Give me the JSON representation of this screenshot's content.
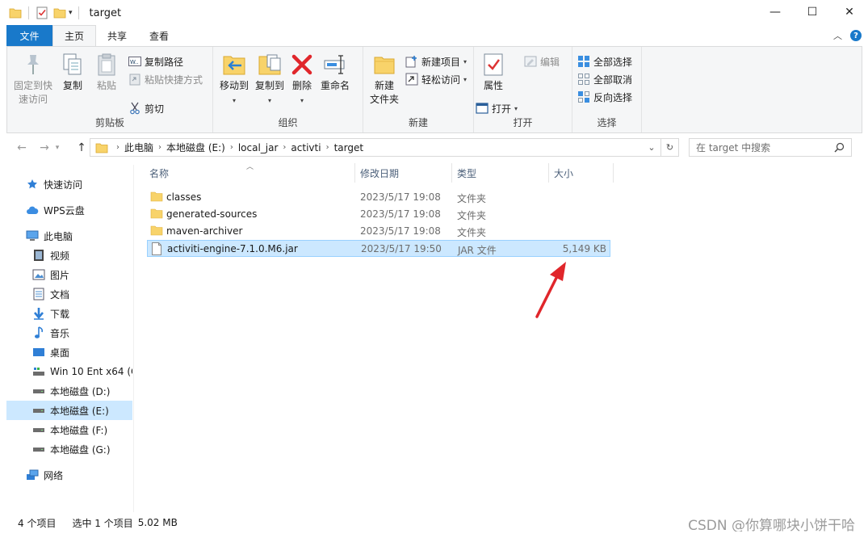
{
  "window": {
    "title": "target",
    "controls": {
      "minimize": "—",
      "maximize": "☐",
      "close": "✕"
    }
  },
  "tabs": [
    {
      "label": "文件"
    },
    {
      "label": "主页"
    },
    {
      "label": "共享"
    },
    {
      "label": "查看"
    }
  ],
  "ribbon": {
    "clipboard": {
      "pin": "固定到快\n速访问",
      "copy": "复制",
      "paste": "粘贴",
      "copy_path": "复制路径",
      "paste_shortcut": "粘贴快捷方式",
      "cut": "剪切",
      "label": "剪贴板"
    },
    "organize": {
      "move_to": "移动到",
      "copy_to": "复制到",
      "delete": "删除",
      "rename": "重命名",
      "label": "组织"
    },
    "new": {
      "new_folder": "新建\n文件夹",
      "new_item": "新建项目",
      "easy_access": "轻松访问",
      "label": "新建"
    },
    "open": {
      "properties": "属性",
      "open": "打开",
      "edit": "编辑",
      "label": "打开"
    },
    "select": {
      "select_all": "全部选择",
      "select_none": "全部取消",
      "invert": "反向选择",
      "label": "选择"
    }
  },
  "address": {
    "crumbs": [
      "此电脑",
      "本地磁盘 (E:)",
      "local_jar",
      "activti",
      "target"
    ]
  },
  "search": {
    "placeholder": "在 target 中搜索"
  },
  "nav": {
    "items": [
      {
        "label": "快速访问",
        "icon": "star-icon"
      },
      {
        "label": "WPS云盘",
        "icon": "cloud-icon"
      },
      {
        "label": "此电脑",
        "icon": "computer-icon"
      },
      {
        "label": "视频",
        "icon": "video-icon"
      },
      {
        "label": "图片",
        "icon": "picture-icon"
      },
      {
        "label": "文档",
        "icon": "document-icon"
      },
      {
        "label": "下载",
        "icon": "download-icon"
      },
      {
        "label": "音乐",
        "icon": "music-icon"
      },
      {
        "label": "桌面",
        "icon": "desktop-icon"
      },
      {
        "label": "Win 10 Ent x64 (C",
        "icon": "drive-icon"
      },
      {
        "label": "本地磁盘 (D:)",
        "icon": "drive-icon"
      },
      {
        "label": "本地磁盘 (E:)",
        "icon": "drive-icon"
      },
      {
        "label": "本地磁盘 (F:)",
        "icon": "drive-icon"
      },
      {
        "label": "本地磁盘 (G:)",
        "icon": "drive-icon"
      },
      {
        "label": "网络",
        "icon": "network-icon"
      }
    ],
    "selected_index": 11
  },
  "columns": {
    "name": "名称",
    "date": "修改日期",
    "type": "类型",
    "size": "大小"
  },
  "files": [
    {
      "name": "classes",
      "date": "2023/5/17 19:08",
      "type": "文件夹",
      "size": "",
      "kind": "folder"
    },
    {
      "name": "generated-sources",
      "date": "2023/5/17 19:08",
      "type": "文件夹",
      "size": "",
      "kind": "folder"
    },
    {
      "name": "maven-archiver",
      "date": "2023/5/17 19:08",
      "type": "文件夹",
      "size": "",
      "kind": "folder"
    },
    {
      "name": "activiti-engine-7.1.0.M6.jar",
      "date": "2023/5/17 19:50",
      "type": "JAR 文件",
      "size": "5,149 KB",
      "kind": "file"
    }
  ],
  "selected_file_index": 3,
  "status": {
    "count": "4 个项目",
    "selection": "选中 1 个项目",
    "size": "5.02 MB"
  },
  "watermark": "CSDN @你算哪块小饼干哈",
  "colors": {
    "accent": "#1979ca",
    "selection": "#cce8ff",
    "arrow": "#e0262b",
    "folder": "#f8d36a"
  }
}
